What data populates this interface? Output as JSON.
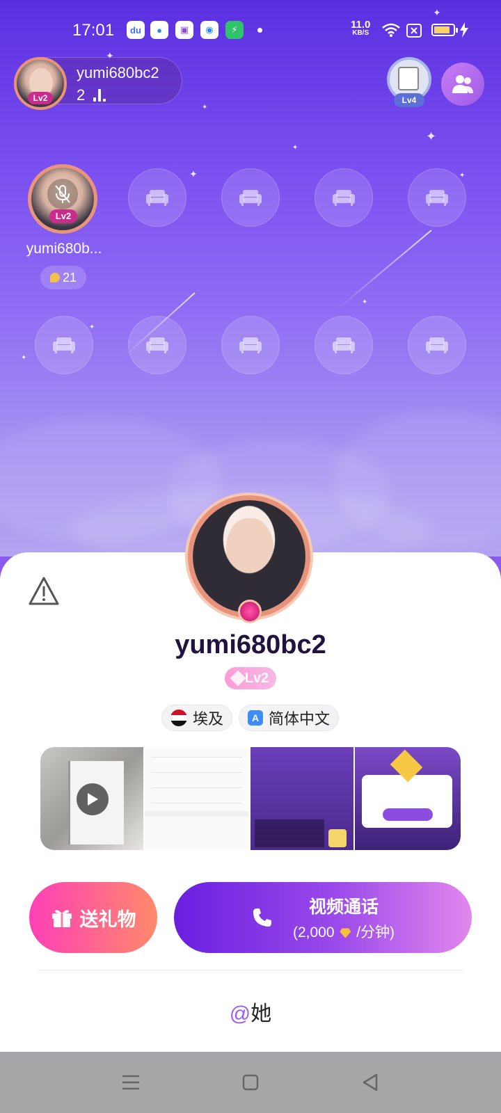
{
  "status_bar": {
    "time": "17:01",
    "network_speed_value": "11.0",
    "network_speed_unit": "KB/S",
    "battery_level": 0.7,
    "app_icons": [
      "baidu-icon",
      "blue-circle-app-icon",
      "purple-tv-app-icon",
      "qq-browser-icon",
      "green-security-app-icon"
    ]
  },
  "room": {
    "host": {
      "name": "yumi680bc2",
      "level": "Lv2",
      "listener_count": "2"
    },
    "trophy_level": "Lv4",
    "seats": [
      {
        "occupied": true,
        "name": "yumi680b...",
        "level": "Lv2",
        "beans": "21",
        "muted": true
      }
    ],
    "empty_seat_count": 9
  },
  "profile": {
    "username": "yumi680bc2",
    "level": "Lv2",
    "country": "埃及",
    "language": "简体中文",
    "gallery": {
      "items": [
        "video",
        "screenshot-settings",
        "screenshot-room",
        "screenshot-reward"
      ]
    }
  },
  "actions": {
    "gift_label": "送礼物",
    "call_title": "视频通话",
    "call_price_prefix": "(2,000",
    "call_price_suffix": "/分钟)",
    "mention_at": "@",
    "mention_label": "她"
  },
  "colors": {
    "accent_purple": "#6a1fe0",
    "gift_gradient_start": "#ff3fb7",
    "gift_gradient_end": "#ff8a6a",
    "level_pink": "#c92c8c"
  }
}
